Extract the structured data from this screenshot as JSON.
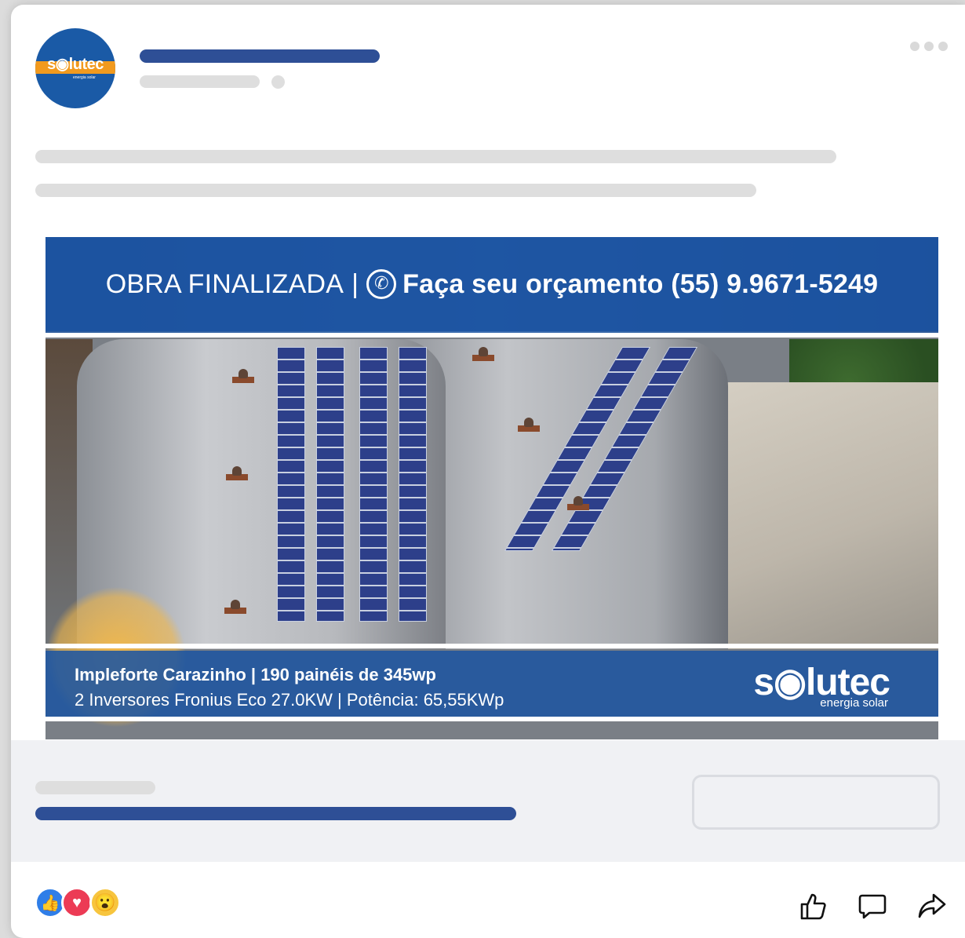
{
  "post": {
    "avatar": {
      "brand": "s◉lutec",
      "tagline": "energia solar"
    }
  },
  "image": {
    "top_banner": {
      "left_text": "OBRA FINALIZADA",
      "separator": "|",
      "cta_text": "Faça seu orçamento (55) 9.9671-5249"
    },
    "bottom_banner": {
      "line1": "Impleforte Carazinho | 190 painéis de 345wp",
      "line2": "2 Inversores Fronius Eco 27.0KW | Potência: 65,55KWp",
      "brand": "s◉lutec",
      "tagline": "energia solar"
    }
  },
  "colors": {
    "skeleton_blue": "#2e4f96",
    "skeleton_gray": "#dedede",
    "footer_bg": "#f0f1f4"
  },
  "icons": {
    "whatsapp": "whatsapp-icon",
    "like_reaction": "like-reaction-icon",
    "love_reaction": "love-reaction-icon",
    "wow_reaction": "wow-reaction-icon",
    "like_action": "thumbs-up-icon",
    "comment_action": "comment-icon",
    "share_action": "share-icon",
    "more": "more-options-icon"
  }
}
